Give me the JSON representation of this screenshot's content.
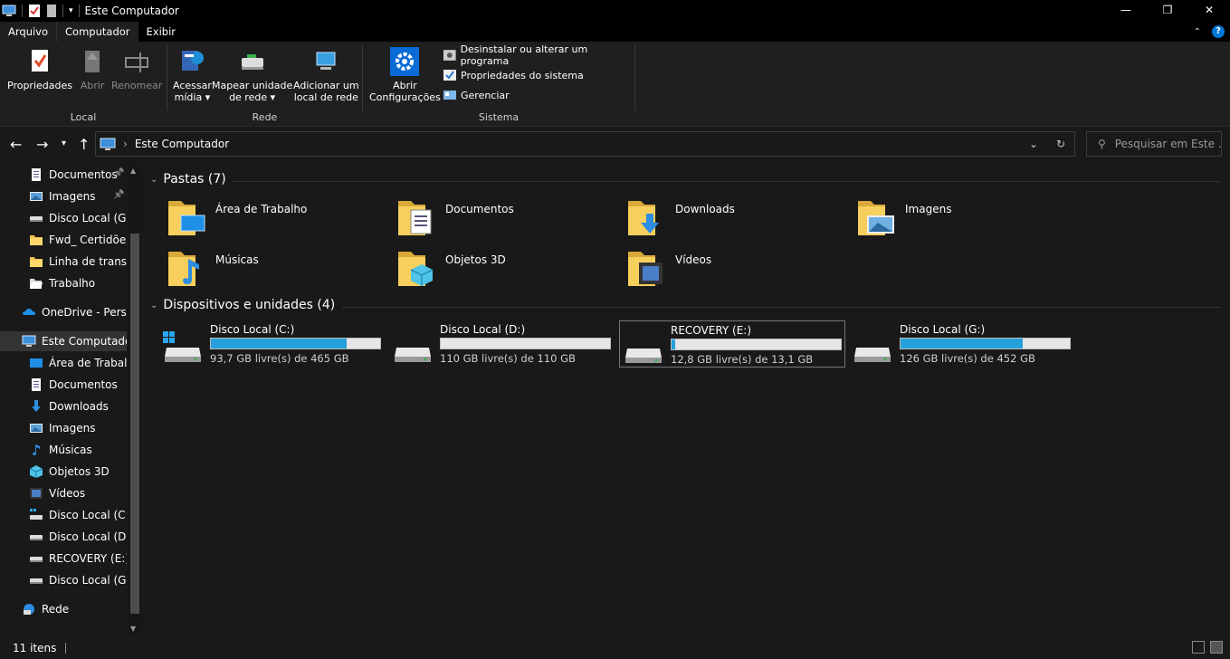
{
  "window": {
    "title": "Este Computador",
    "controls": [
      "—",
      "❐",
      "✕"
    ]
  },
  "ribbon_tabs": [
    "Arquivo",
    "Computador",
    "Exibir"
  ],
  "ribbon": {
    "local": {
      "label": "Local",
      "buttons": [
        "Propriedades",
        "Abrir",
        "Renomear"
      ]
    },
    "rede": {
      "label": "Rede",
      "acessar": [
        "Acessar",
        "mídia ▾"
      ],
      "mapear": [
        "Mapear unidade",
        "de rede ▾"
      ],
      "adicionar": [
        "Adicionar um",
        "local de rede"
      ]
    },
    "sistema": {
      "label": "Sistema",
      "abrir": [
        "Abrir",
        "Configurações"
      ],
      "items": [
        "Desinstalar ou alterar um programa",
        "Propriedades do sistema",
        "Gerenciar"
      ]
    }
  },
  "address": {
    "path": "Este Computador",
    "search_placeholder": "Pesquisar em Este ..."
  },
  "sidebar": {
    "quick": [
      {
        "label": "Documentos",
        "icon": "documents-icon",
        "pinned": true
      },
      {
        "label": "Imagens",
        "icon": "pictures-icon",
        "pinned": true
      },
      {
        "label": "Disco Local (G:)",
        "icon": "drive-icon",
        "pinned": false
      },
      {
        "label": "Fwd_ Certidões S",
        "icon": "folder-icon",
        "pinned": false
      },
      {
        "label": "Linha de transm",
        "icon": "folder-icon",
        "pinned": false
      },
      {
        "label": "Trabalho",
        "icon": "folder-open-icon",
        "pinned": false
      }
    ],
    "onedrive": "OneDrive - Person",
    "thispc": "Este Computador",
    "thispc_items": [
      {
        "label": "Área de Trabalho",
        "icon": "desktop-icon"
      },
      {
        "label": "Documentos",
        "icon": "documents-icon"
      },
      {
        "label": "Downloads",
        "icon": "downloads-icon"
      },
      {
        "label": "Imagens",
        "icon": "pictures-icon"
      },
      {
        "label": "Músicas",
        "icon": "music-icon"
      },
      {
        "label": "Objetos 3D",
        "icon": "objects3d-icon"
      },
      {
        "label": "Vídeos",
        "icon": "videos-icon"
      },
      {
        "label": "Disco Local (C:)",
        "icon": "windows-drive-icon"
      },
      {
        "label": "Disco Local (D:)",
        "icon": "drive-icon"
      },
      {
        "label": "RECOVERY (E:)",
        "icon": "drive-icon"
      },
      {
        "label": "Disco Local (G:)",
        "icon": "drive-icon"
      }
    ],
    "network": "Rede"
  },
  "folders_section": "Pastas (7)",
  "folders": [
    {
      "name": "Área de Trabalho",
      "icon": "desktop-folder-icon"
    },
    {
      "name": "Documentos",
      "icon": "documents-folder-icon"
    },
    {
      "name": "Downloads",
      "icon": "downloads-folder-icon"
    },
    {
      "name": "Imagens",
      "icon": "pictures-folder-icon"
    },
    {
      "name": "Músicas",
      "icon": "music-folder-icon"
    },
    {
      "name": "Objetos 3D",
      "icon": "objects3d-folder-icon"
    },
    {
      "name": "Vídeos",
      "icon": "videos-folder-icon"
    }
  ],
  "drives_section": "Dispositivos e unidades (4)",
  "drives": [
    {
      "name": "Disco Local (C:)",
      "free": "93,7 GB livre(s) de 465 GB",
      "used_fraction": 0.8,
      "system": true,
      "selected": false
    },
    {
      "name": "Disco Local (D:)",
      "free": "110 GB livre(s) de 110 GB",
      "used_fraction": 0.0,
      "system": false,
      "selected": false
    },
    {
      "name": "RECOVERY (E:)",
      "free": "12,8 GB livre(s) de 13,1 GB",
      "used_fraction": 0.02,
      "system": false,
      "selected": true
    },
    {
      "name": "Disco Local (G:)",
      "free": "126 GB livre(s) de 452 GB",
      "used_fraction": 0.72,
      "system": false,
      "selected": false
    }
  ],
  "status": {
    "count": "11 itens"
  },
  "colors": {
    "bar_fill": "#26a0da",
    "folder": "#f4c24e",
    "accent": "#0078d7"
  }
}
